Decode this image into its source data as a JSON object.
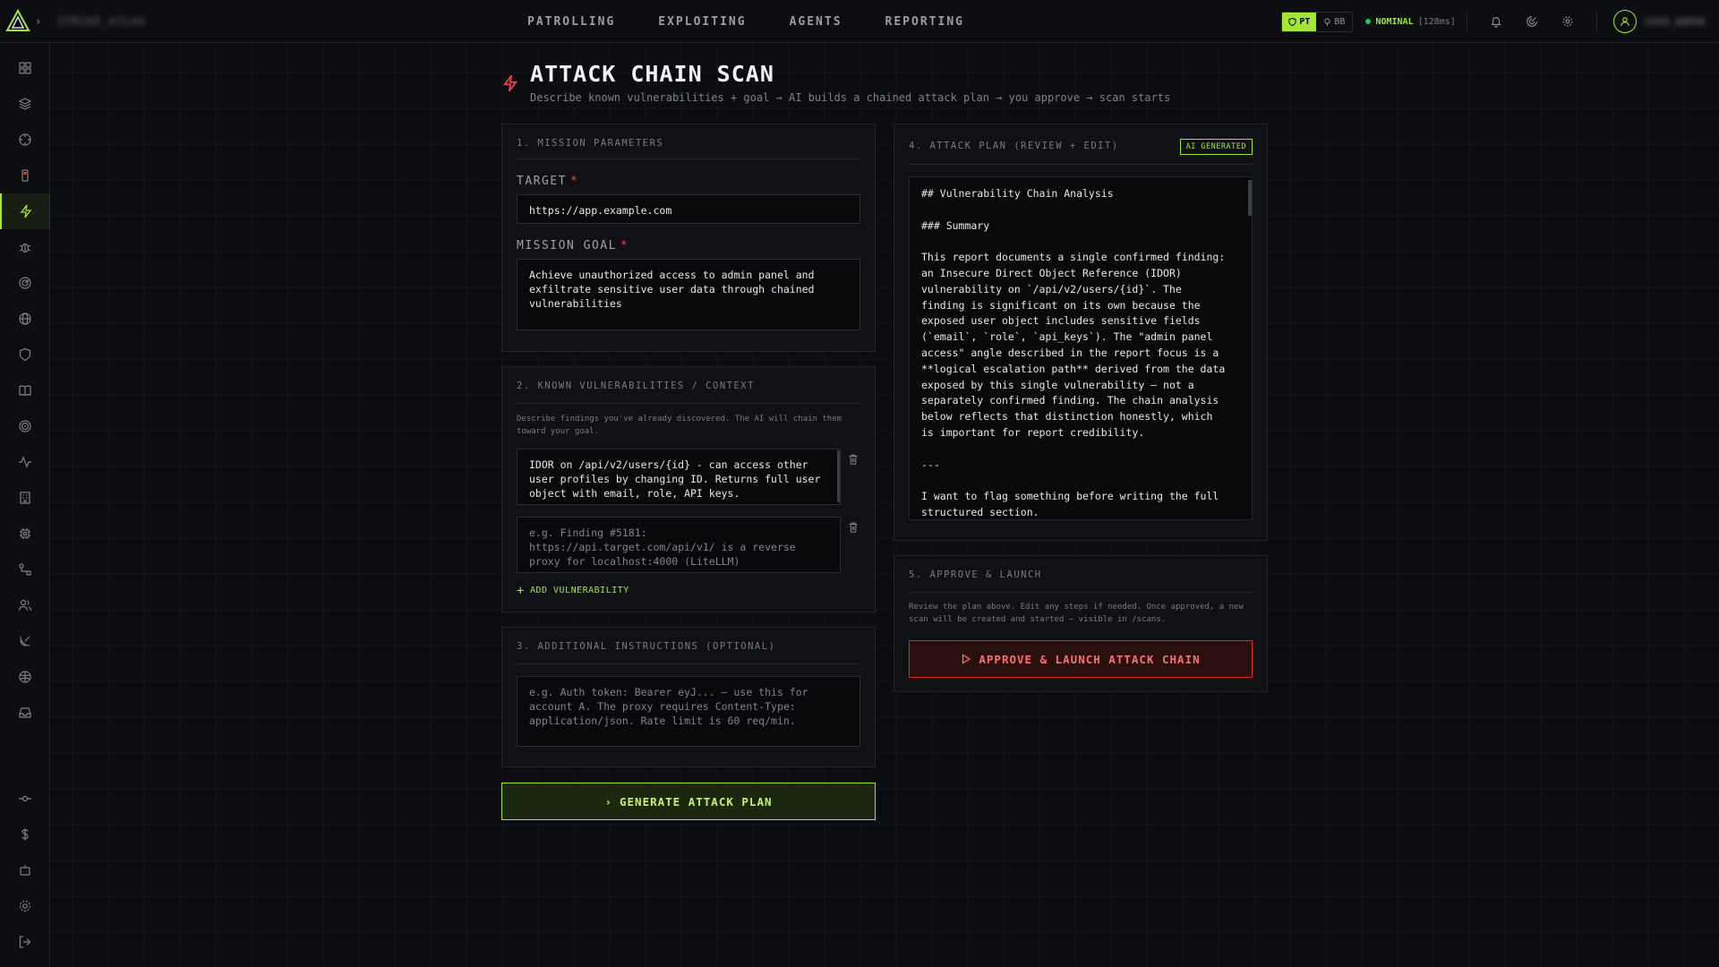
{
  "topbar": {
    "org_name": "STRIKE_ATLAS",
    "nav": [
      "PATROLLING",
      "EXPLOITING",
      "AGENTS",
      "REPORTING"
    ],
    "mode_pt": "PT",
    "mode_bb": "BB",
    "status_label": "NOMINAL",
    "status_latency": "[128ms]",
    "user_name": "USER_ADMIN"
  },
  "header": {
    "title": "ATTACK CHAIN SCAN",
    "subtitle": "Describe known vulnerabilities + goal → AI builds a chained attack plan → you approve → scan starts"
  },
  "mission": {
    "section_title": "1. MISSION PARAMETERS",
    "target_label": "TARGET",
    "target_value": "https://app.example.com",
    "goal_label": "MISSION GOAL",
    "goal_value": "Achieve unauthorized access to admin panel and exfiltrate sensitive user data through chained vulnerabilities",
    "required_mark": "*"
  },
  "vulns": {
    "section_title": "2. KNOWN VULNERABILITIES / CONTEXT",
    "helper": "Describe findings you've already discovered. The AI will chain them toward your goal.",
    "items": [
      {
        "value": "IDOR on /api/v2/users/{id} - can access other user profiles by changing ID. Returns full user object with email, role, API keys.",
        "placeholder": ""
      },
      {
        "value": "",
        "placeholder": "e.g. Finding #5181: https://api.target.com/api/v1/ is a reverse proxy for localhost:4000 (LiteLLM)"
      }
    ],
    "add_label": "ADD VULNERABILITY"
  },
  "instructions": {
    "section_title": "3. ADDITIONAL INSTRUCTIONS (OPTIONAL)",
    "placeholder": "e.g. Auth token: Bearer eyJ... — use this for account A. The proxy requires Content-Type: application/json. Rate limit is 60 req/min."
  },
  "generate_button": "GENERATE ATTACK PLAN",
  "plan": {
    "section_title": "4. ATTACK PLAN (REVIEW + EDIT)",
    "badge": "AI GENERATED",
    "content": "## Vulnerability Chain Analysis\n\n### Summary\n\nThis report documents a single confirmed finding: an Insecure Direct Object Reference (IDOR) vulnerability on `/api/v2/users/{id}`. The finding is significant on its own because the exposed user object includes sensitive fields (`email`, `role`, `api_keys`). The \"admin panel access\" angle described in the report focus is a **logical escalation path** derived from the data exposed by this single vulnerability — not a separately confirmed finding. The chain analysis below reflects that distinction honestly, which is important for report credibility.\n\n---\n\nI want to flag something before writing the full structured section."
  },
  "approve": {
    "section_title": "5. APPROVE & LAUNCH",
    "helper": "Review the plan above. Edit any steps if needed. Once approved, a new scan will be created and started — visible in /scans.",
    "button": "APPROVE & LAUNCH ATTACK CHAIN"
  }
}
